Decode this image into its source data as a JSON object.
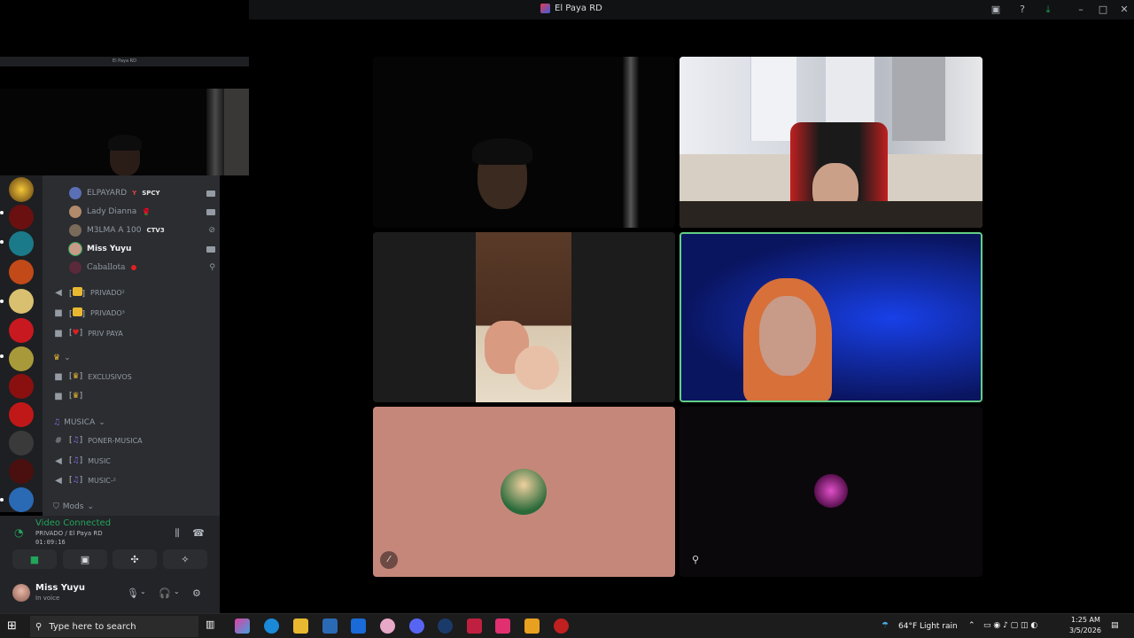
{
  "window": {
    "title": "El Paya RD"
  },
  "popout": {
    "title": "El Paya RD"
  },
  "voice_users": [
    {
      "name": "ELPAYARD",
      "tag": "SPCY",
      "tag_prefix": "Y",
      "state": "camera",
      "avatar_color": "#5a6fb5"
    },
    {
      "name": "Lady Dianna",
      "tag": "",
      "tag_prefix": "",
      "state": "camera",
      "avatar_color": "#b08a6a"
    },
    {
      "name": "M3LMA A 100",
      "tag": "CTV3",
      "tag_prefix": "",
      "state": "deafened",
      "avatar_color": "#7a6a5a"
    },
    {
      "name": "Miss Yuyu",
      "tag": "",
      "tag_prefix": "",
      "state": "camera",
      "avatar_color": "#c89a88",
      "active": true
    },
    {
      "name": "Caballota",
      "tag": "",
      "tag_prefix": "",
      "state": "stream",
      "avatar_color": "#5a2a3a"
    }
  ],
  "channels": [
    {
      "type": "voice",
      "locked": false,
      "label": "PRIVADO²"
    },
    {
      "type": "voice",
      "locked": true,
      "label": "PRIVADO³"
    },
    {
      "type": "voice",
      "locked": true,
      "label": "PRIV PAYA"
    },
    {
      "type": "voice",
      "locked": true,
      "label": "EXCLUSIVOS"
    },
    {
      "type": "voice",
      "locked": true,
      "label": ""
    },
    {
      "type": "text",
      "locked": false,
      "label": "PONER-MUSICA"
    },
    {
      "type": "voice",
      "locked": false,
      "label": "MUSIC"
    },
    {
      "type": "voice",
      "locked": false,
      "label": "MUSIC-²"
    }
  ],
  "categories": {
    "musica": "MUSICA",
    "mods": "Mods"
  },
  "voice_panel": {
    "status": "Video Connected",
    "channel": "PRIVADO / El Paya RD",
    "elapsed": "01:09:16"
  },
  "user_panel": {
    "name": "Miss Yuyu",
    "status": "In voice"
  },
  "taskbar": {
    "search_placeholder": "Type here to search",
    "weather": "64°F  Light rain",
    "time": "1:25 AM",
    "date": "3/5/2026"
  },
  "colors": {
    "connected": "#23a55a",
    "speaking_border": "#63cf84",
    "t5_bg": "#c6877b"
  }
}
